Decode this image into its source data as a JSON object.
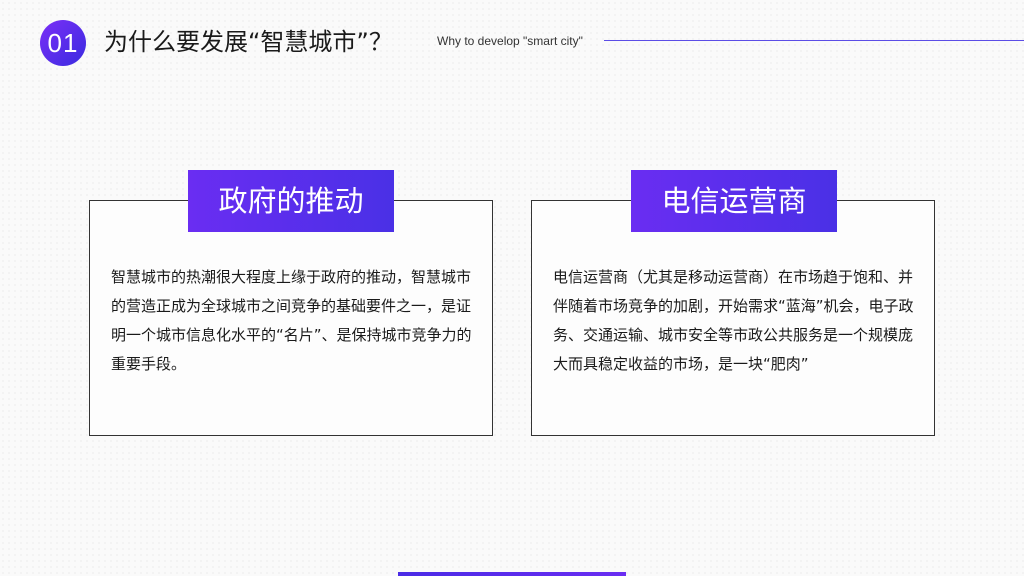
{
  "header": {
    "number": "01",
    "title": "为什么要发展“智慧城市”？",
    "subtitle": "Why to develop \"smart city\""
  },
  "cards": [
    {
      "heading": "政府的推动",
      "body": "智慧城市的热潮很大程度上缘于政府的推动，智慧城市的营造正成为全球城市之间竞争的基础要件之一，是证明一个城市信息化水平的“名片”、是保持城市竞争力的重要手段。"
    },
    {
      "heading": "电信运营商",
      "body": "电信运营商（尤其是移动运营商）在市场趋于饱和、并伴随着市场竞争的加剧，开始需求“蓝海”机会，电子政务、交通运输、城市安全等市政公共服务是一个规模庞大而具稳定收益的市场，是一块“肥肉”"
    }
  ],
  "colors": {
    "accent": "#5b2ff0",
    "accent_dark": "#3a2be0"
  }
}
